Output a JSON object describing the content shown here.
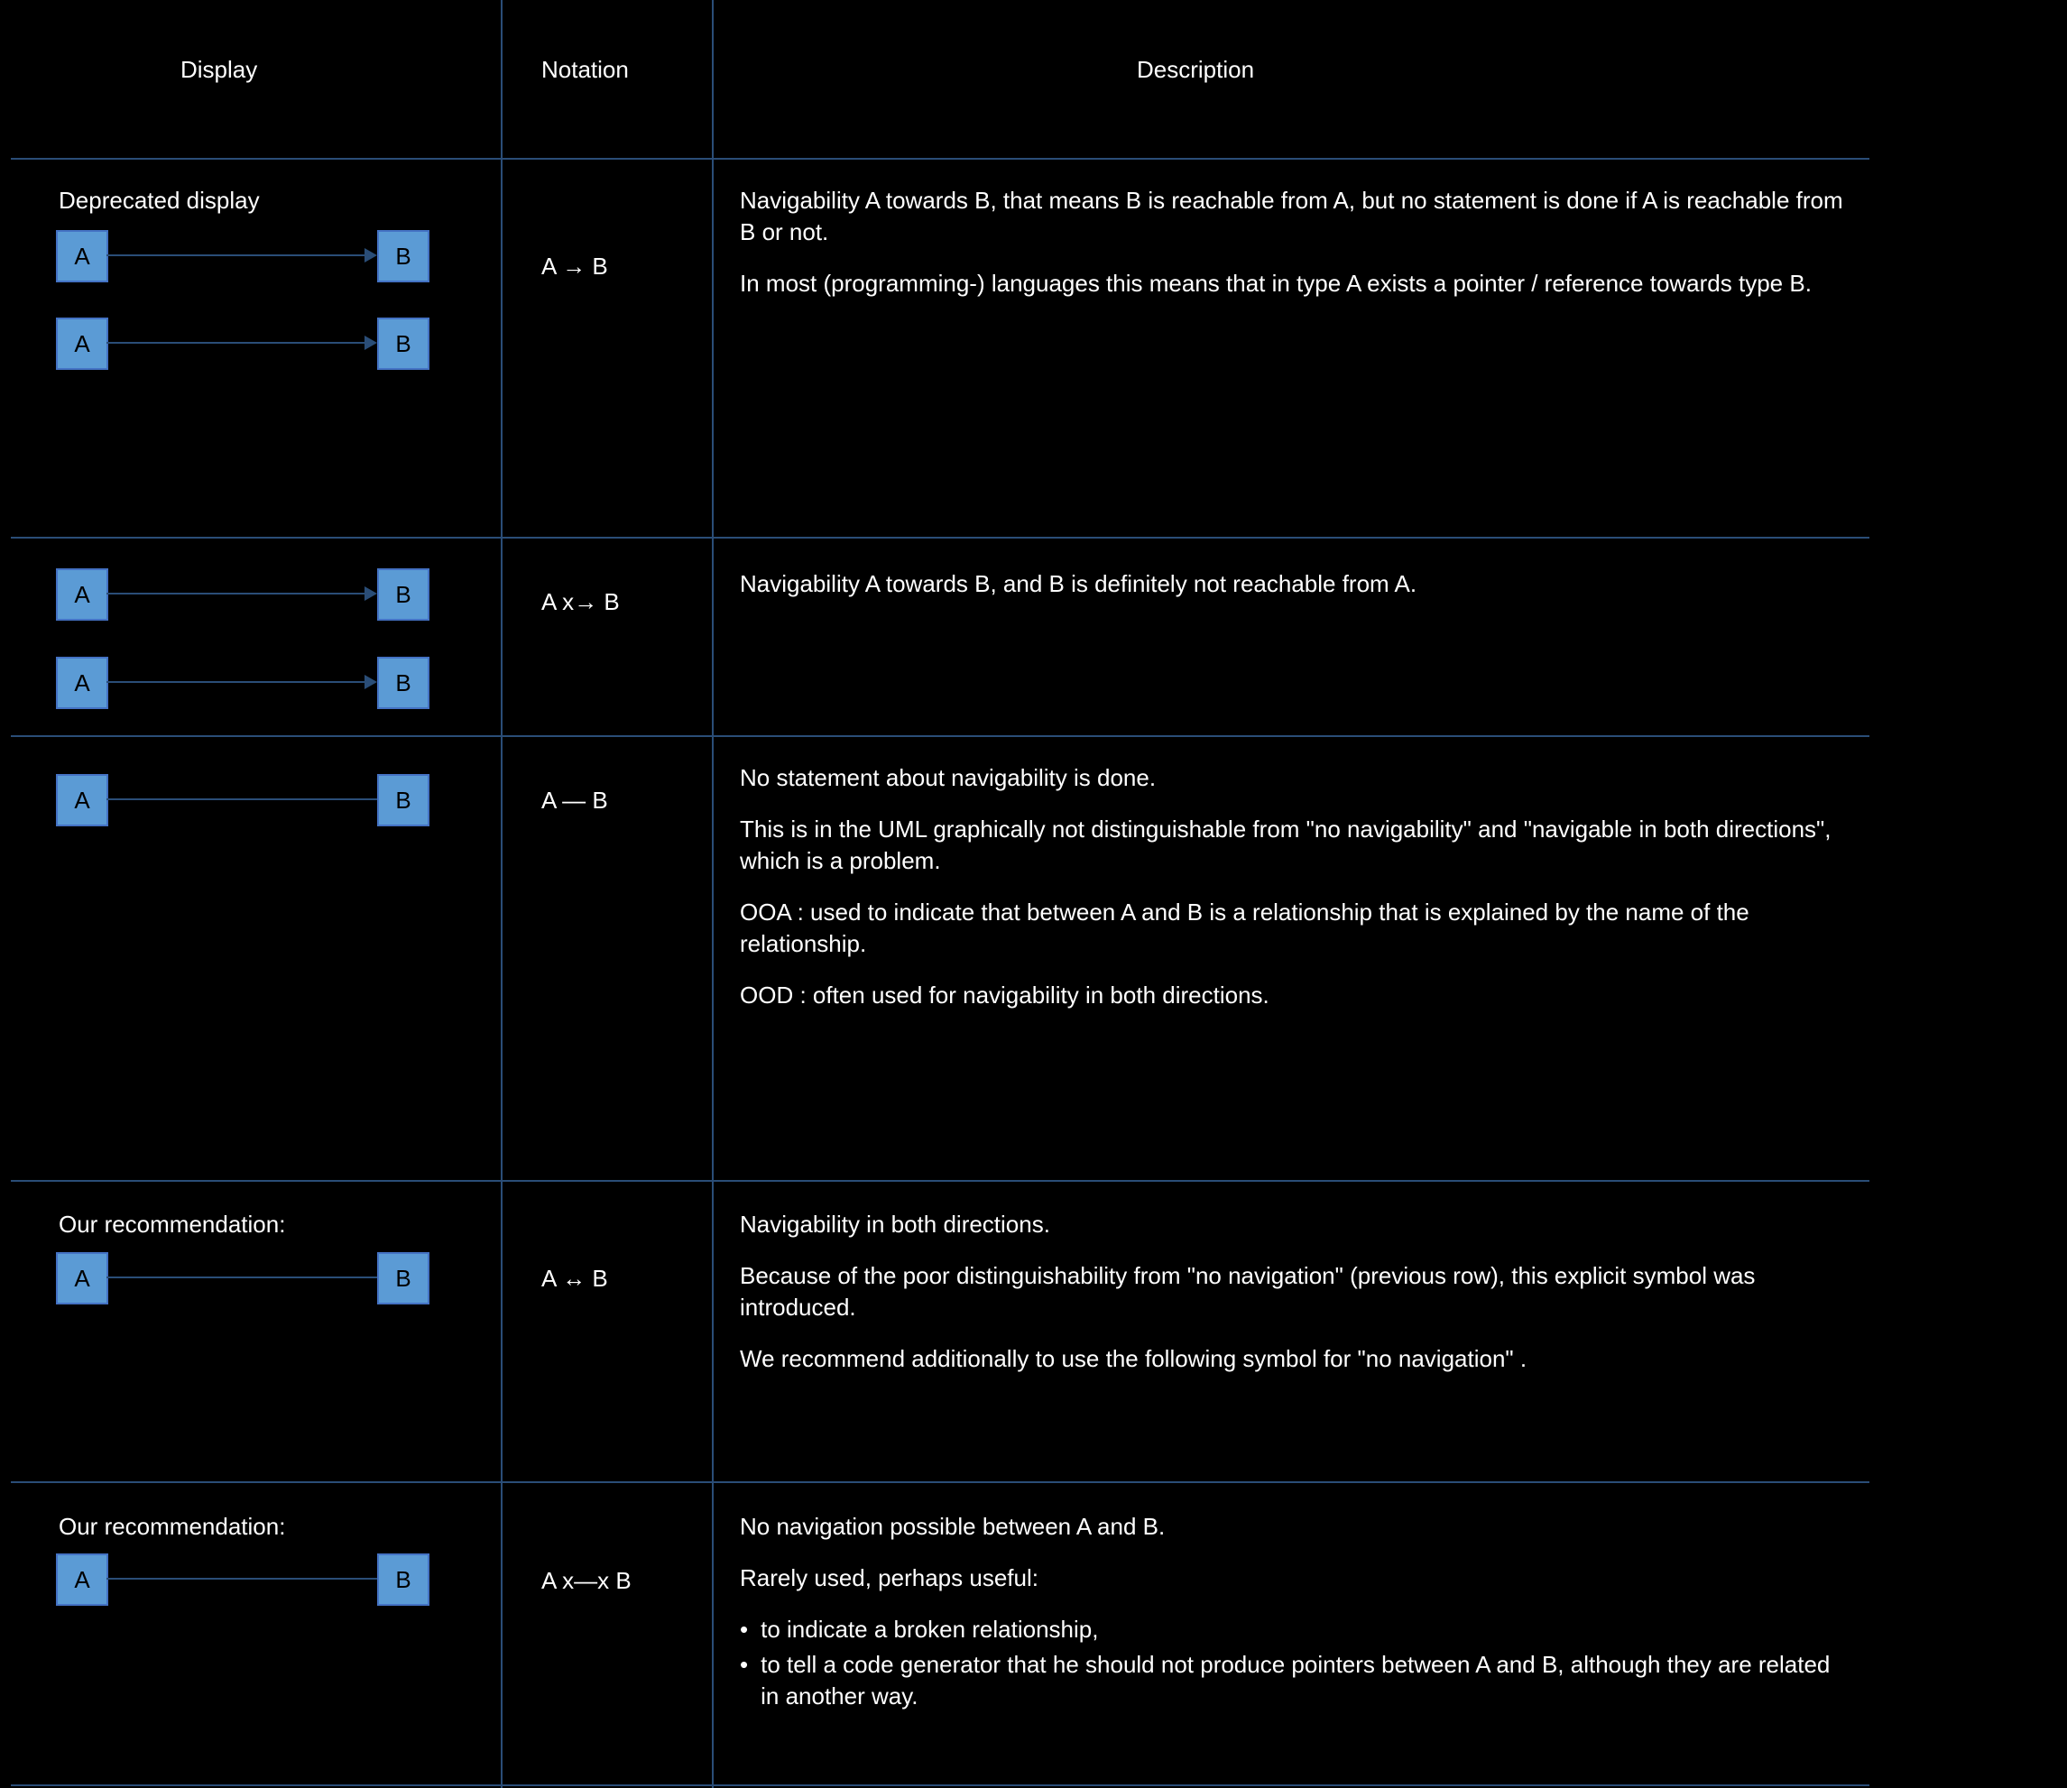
{
  "headers": {
    "display": "Display",
    "notation": "Notation",
    "description": "Description"
  },
  "nodes": {
    "A": "A",
    "B": "B"
  },
  "rows": [
    {
      "notation": "A → B",
      "desc": {
        "paras": [
          "Navigability A towards B, that means B is reachable from A, but no statement is done if A is reachable from B or not.",
          "In most (programming-) languages this means that in type A exists a pointer / reference towards type B."
        ],
        "bullets": []
      }
    },
    {
      "notation": "A x→ B",
      "desc": {
        "paras": [
          "Navigability A towards B, and B is definitely not reachable from A."
        ],
        "bullets": []
      }
    },
    {
      "notation": "A — B",
      "desc": {
        "paras": [
          "No statement about navigability is done.",
          "This is in the UML graphically not distinguishable from \"no navigability\" and \"navigable in both directions\", which is a problem.",
          "OOA : used to indicate that between A and B is a relationship that is explained by the name of the relationship.",
          "OOD : often used for navigability in both directions."
        ],
        "bullets": []
      }
    },
    {
      "notation": "A ↔ B",
      "desc": {
        "paras": [
          "Navigability in both directions.",
          "Because of the poor distinguishability from \"no navigation\" (previous row), this explicit symbol was introduced.",
          "We recommend additionally to use the following symbol for \"no navigation\" ."
        ],
        "bullets": []
      }
    },
    {
      "notation": "A x—x B",
      "desc": {
        "paras": [
          "No navigation possible between A and B.",
          "Rarely used, perhaps useful:"
        ],
        "bullets": [
          "to indicate a broken relationship,",
          "to tell a code generator that he should not produce pointers between A and B, although they are related in another way."
        ]
      }
    }
  ],
  "diagram": [
    {
      "hasCaption": true,
      "caption": "Deprecated display",
      "arrow": true,
      "cross": false,
      "nodes": [
        [
          "A",
          "B"
        ],
        [
          "A",
          "B"
        ]
      ]
    },
    {
      "hasCaption": false,
      "arrow": true,
      "cross": true,
      "nodes": [
        [
          "A",
          "B"
        ],
        [
          "A",
          "B"
        ]
      ]
    },
    {
      "hasCaption": false,
      "arrow": false,
      "cross": false,
      "nodes": [
        [
          "A",
          "B"
        ]
      ]
    },
    {
      "hasCaption": true,
      "caption": "Our recommendation:",
      "arrow": false,
      "cross": false,
      "bidir": true,
      "nodes": [
        [
          "A",
          "B"
        ]
      ]
    },
    {
      "hasCaption": true,
      "caption": "Our recommendation:",
      "arrow": false,
      "cross": true,
      "doublecross": true,
      "nodes": [
        [
          "A",
          "B"
        ]
      ]
    }
  ]
}
